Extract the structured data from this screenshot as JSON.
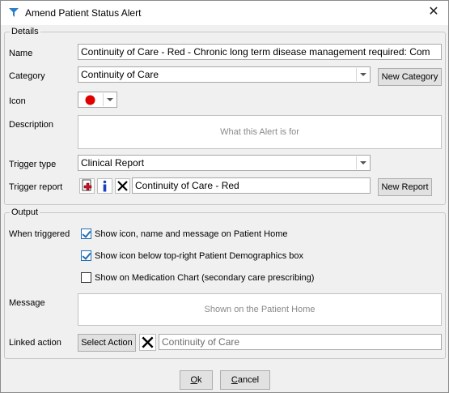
{
  "window": {
    "title": "Amend Patient Status Alert"
  },
  "details": {
    "legend": "Details",
    "name": {
      "label": "Name",
      "value": "Continuity of Care - Red - Chronic long term disease management required: Com"
    },
    "category": {
      "label": "Category",
      "value": "Continuity of Care",
      "new_button": "New Category"
    },
    "icon": {
      "label": "Icon",
      "color": "#e00000"
    },
    "description": {
      "label": "Description",
      "placeholder": "What this Alert is for"
    },
    "trigger_type": {
      "label": "Trigger type",
      "value": "Clinical Report"
    },
    "trigger_report": {
      "label": "Trigger report",
      "value": "Continuity of Care - Red",
      "new_button": "New Report"
    }
  },
  "output": {
    "legend": "Output",
    "when_triggered_label": "When triggered",
    "options": [
      {
        "label": "Show icon, name and message on Patient Home",
        "checked": true
      },
      {
        "label": "Show icon below top-right Patient Demographics box",
        "checked": true
      },
      {
        "label": "Show on Medication Chart (secondary care prescribing)",
        "checked": false
      }
    ],
    "message": {
      "label": "Message",
      "placeholder": "Shown on the Patient Home"
    },
    "linked_action": {
      "label": "Linked action",
      "button": "Select Action",
      "value": "Continuity of Care"
    }
  },
  "footer": {
    "ok_prefix": "O",
    "ok_rest": "k",
    "cancel_prefix": "C",
    "cancel_rest": "ancel"
  },
  "colors": {
    "accent": "#1f6fb8",
    "icon_red": "#e00000",
    "plus_red": "#c8102e"
  }
}
